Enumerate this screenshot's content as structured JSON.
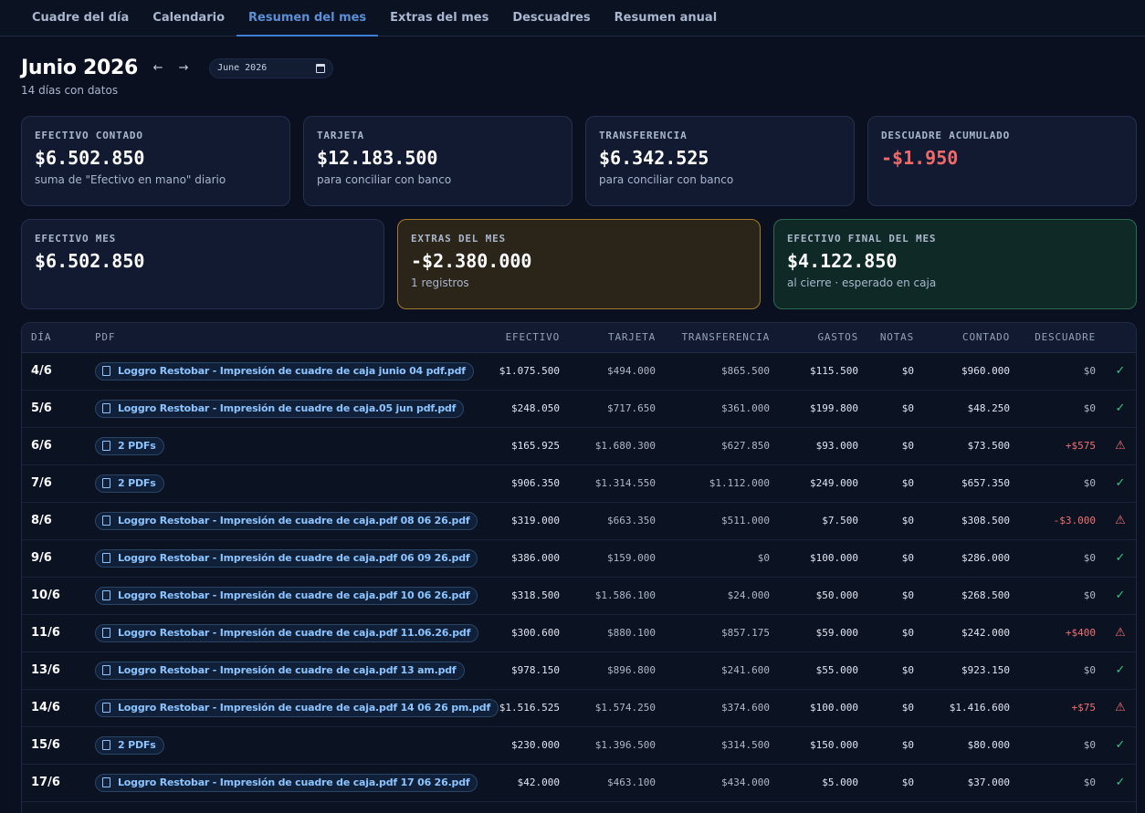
{
  "nav": {
    "tabs": [
      {
        "label": "Cuadre del día",
        "active": false
      },
      {
        "label": "Calendario",
        "active": false
      },
      {
        "label": "Resumen del mes",
        "active": true
      },
      {
        "label": "Extras del mes",
        "active": false
      },
      {
        "label": "Descuadres",
        "active": false
      },
      {
        "label": "Resumen anual",
        "active": false
      }
    ]
  },
  "header": {
    "title": "Junio 2026",
    "prev_icon": "←",
    "next_icon": "→",
    "month_value": "June 2026",
    "subtitle": "14 días con datos"
  },
  "cards_row1": [
    {
      "label": "EFECTIVO CONTADO",
      "value": "$6.502.850",
      "note": "suma de \"Efectivo en mano\" diario"
    },
    {
      "label": "TARJETA",
      "value": "$12.183.500",
      "note": "para conciliar con banco"
    },
    {
      "label": "TRANSFERENCIA",
      "value": "$6.342.525",
      "note": "para conciliar con banco"
    },
    {
      "label": "DESCUADRE ACUMULADO",
      "value": "-$1.950",
      "note": ""
    }
  ],
  "cards_row2": [
    {
      "label": "EFECTIVO MES",
      "value": "$6.502.850",
      "note": ""
    },
    {
      "label": "EXTRAS DEL MES",
      "value": "-$2.380.000",
      "note": "1 registros"
    },
    {
      "label": "EFECTIVO FINAL DEL MES",
      "value": "$4.122.850",
      "note": "al cierre · esperado en caja"
    }
  ],
  "table": {
    "headers": [
      "DÍA",
      "PDF",
      "EFECTIVO",
      "TARJETA",
      "TRANSFERENCIA",
      "GASTOS",
      "NOTAS",
      "CONTADO",
      "DESCUADRE"
    ],
    "rows": [
      {
        "day": "4/6",
        "pdf": "Loggro Restobar - Impresión de cuadre de caja junio 04 pdf.pdf",
        "efectivo": "$1.075.500",
        "tarjeta": "$494.000",
        "transferencia": "$865.500",
        "gastos": "$115.500",
        "notas": "$0",
        "contado": "$960.000",
        "descuadre": "$0",
        "status": "ok"
      },
      {
        "day": "5/6",
        "pdf": "Loggro Restobar - Impresión de cuadre de caja.05 jun pdf.pdf",
        "efectivo": "$248.050",
        "tarjeta": "$717.650",
        "transferencia": "$361.000",
        "gastos": "$199.800",
        "notas": "$0",
        "contado": "$48.250",
        "descuadre": "$0",
        "status": "ok"
      },
      {
        "day": "6/6",
        "pdf": "2 PDFs",
        "efectivo": "$165.925",
        "tarjeta": "$1.680.300",
        "transferencia": "$627.850",
        "gastos": "$93.000",
        "notas": "$0",
        "contado": "$73.500",
        "descuadre": "+$575",
        "status": "warn"
      },
      {
        "day": "7/6",
        "pdf": "2 PDFs",
        "efectivo": "$906.350",
        "tarjeta": "$1.314.550",
        "transferencia": "$1.112.000",
        "gastos": "$249.000",
        "notas": "$0",
        "contado": "$657.350",
        "descuadre": "$0",
        "status": "ok"
      },
      {
        "day": "8/6",
        "pdf": "Loggro Restobar - Impresión de cuadre de caja.pdf 08 06 26.pdf",
        "efectivo": "$319.000",
        "tarjeta": "$663.350",
        "transferencia": "$511.000",
        "gastos": "$7.500",
        "notas": "$0",
        "contado": "$308.500",
        "descuadre": "-$3.000",
        "status": "warn"
      },
      {
        "day": "9/6",
        "pdf": "Loggro Restobar - Impresión de cuadre de caja.pdf 06 09 26.pdf",
        "efectivo": "$386.000",
        "tarjeta": "$159.000",
        "transferencia": "$0",
        "gastos": "$100.000",
        "notas": "$0",
        "contado": "$286.000",
        "descuadre": "$0",
        "status": "ok"
      },
      {
        "day": "10/6",
        "pdf": "Loggro Restobar - Impresión de cuadre de caja.pdf 10 06 26.pdf",
        "efectivo": "$318.500",
        "tarjeta": "$1.586.100",
        "transferencia": "$24.000",
        "gastos": "$50.000",
        "notas": "$0",
        "contado": "$268.500",
        "descuadre": "$0",
        "status": "ok"
      },
      {
        "day": "11/6",
        "pdf": "Loggro Restobar - Impresión de cuadre de caja.pdf 11.06.26.pdf",
        "efectivo": "$300.600",
        "tarjeta": "$880.100",
        "transferencia": "$857.175",
        "gastos": "$59.000",
        "notas": "$0",
        "contado": "$242.000",
        "descuadre": "+$400",
        "status": "warn"
      },
      {
        "day": "13/6",
        "pdf": "Loggro Restobar - Impresión de cuadre de caja.pdf 13 am.pdf",
        "efectivo": "$978.150",
        "tarjeta": "$896.800",
        "transferencia": "$241.600",
        "gastos": "$55.000",
        "notas": "$0",
        "contado": "$923.150",
        "descuadre": "$0",
        "status": "ok"
      },
      {
        "day": "14/6",
        "pdf": "Loggro Restobar - Impresión de cuadre de caja.pdf 14 06 26 pm.pdf",
        "efectivo": "$1.516.525",
        "tarjeta": "$1.574.250",
        "transferencia": "$374.600",
        "gastos": "$100.000",
        "notas": "$0",
        "contado": "$1.416.600",
        "descuadre": "+$75",
        "status": "warn"
      },
      {
        "day": "15/6",
        "pdf": "2 PDFs",
        "efectivo": "$230.000",
        "tarjeta": "$1.396.500",
        "transferencia": "$314.500",
        "gastos": "$150.000",
        "notas": "$0",
        "contado": "$80.000",
        "descuadre": "$0",
        "status": "ok"
      },
      {
        "day": "17/6",
        "pdf": "Loggro Restobar - Impresión de cuadre de caja.pdf 17 06 26.pdf",
        "efectivo": "$42.000",
        "tarjeta": "$463.100",
        "transferencia": "$434.000",
        "gastos": "$5.000",
        "notas": "$0",
        "contado": "$37.000",
        "descuadre": "$0",
        "status": "ok"
      }
    ]
  },
  "icons": {
    "ok": "check-icon",
    "warn": "warning-triangle-icon",
    "pdf": "document-icon"
  },
  "colors": {
    "accent": "#3d7fd6",
    "negative": "#f06a6a",
    "positive_ok": "#3ec07c",
    "extras_border": "#a47a2a",
    "final_border": "#2b6b4c"
  }
}
